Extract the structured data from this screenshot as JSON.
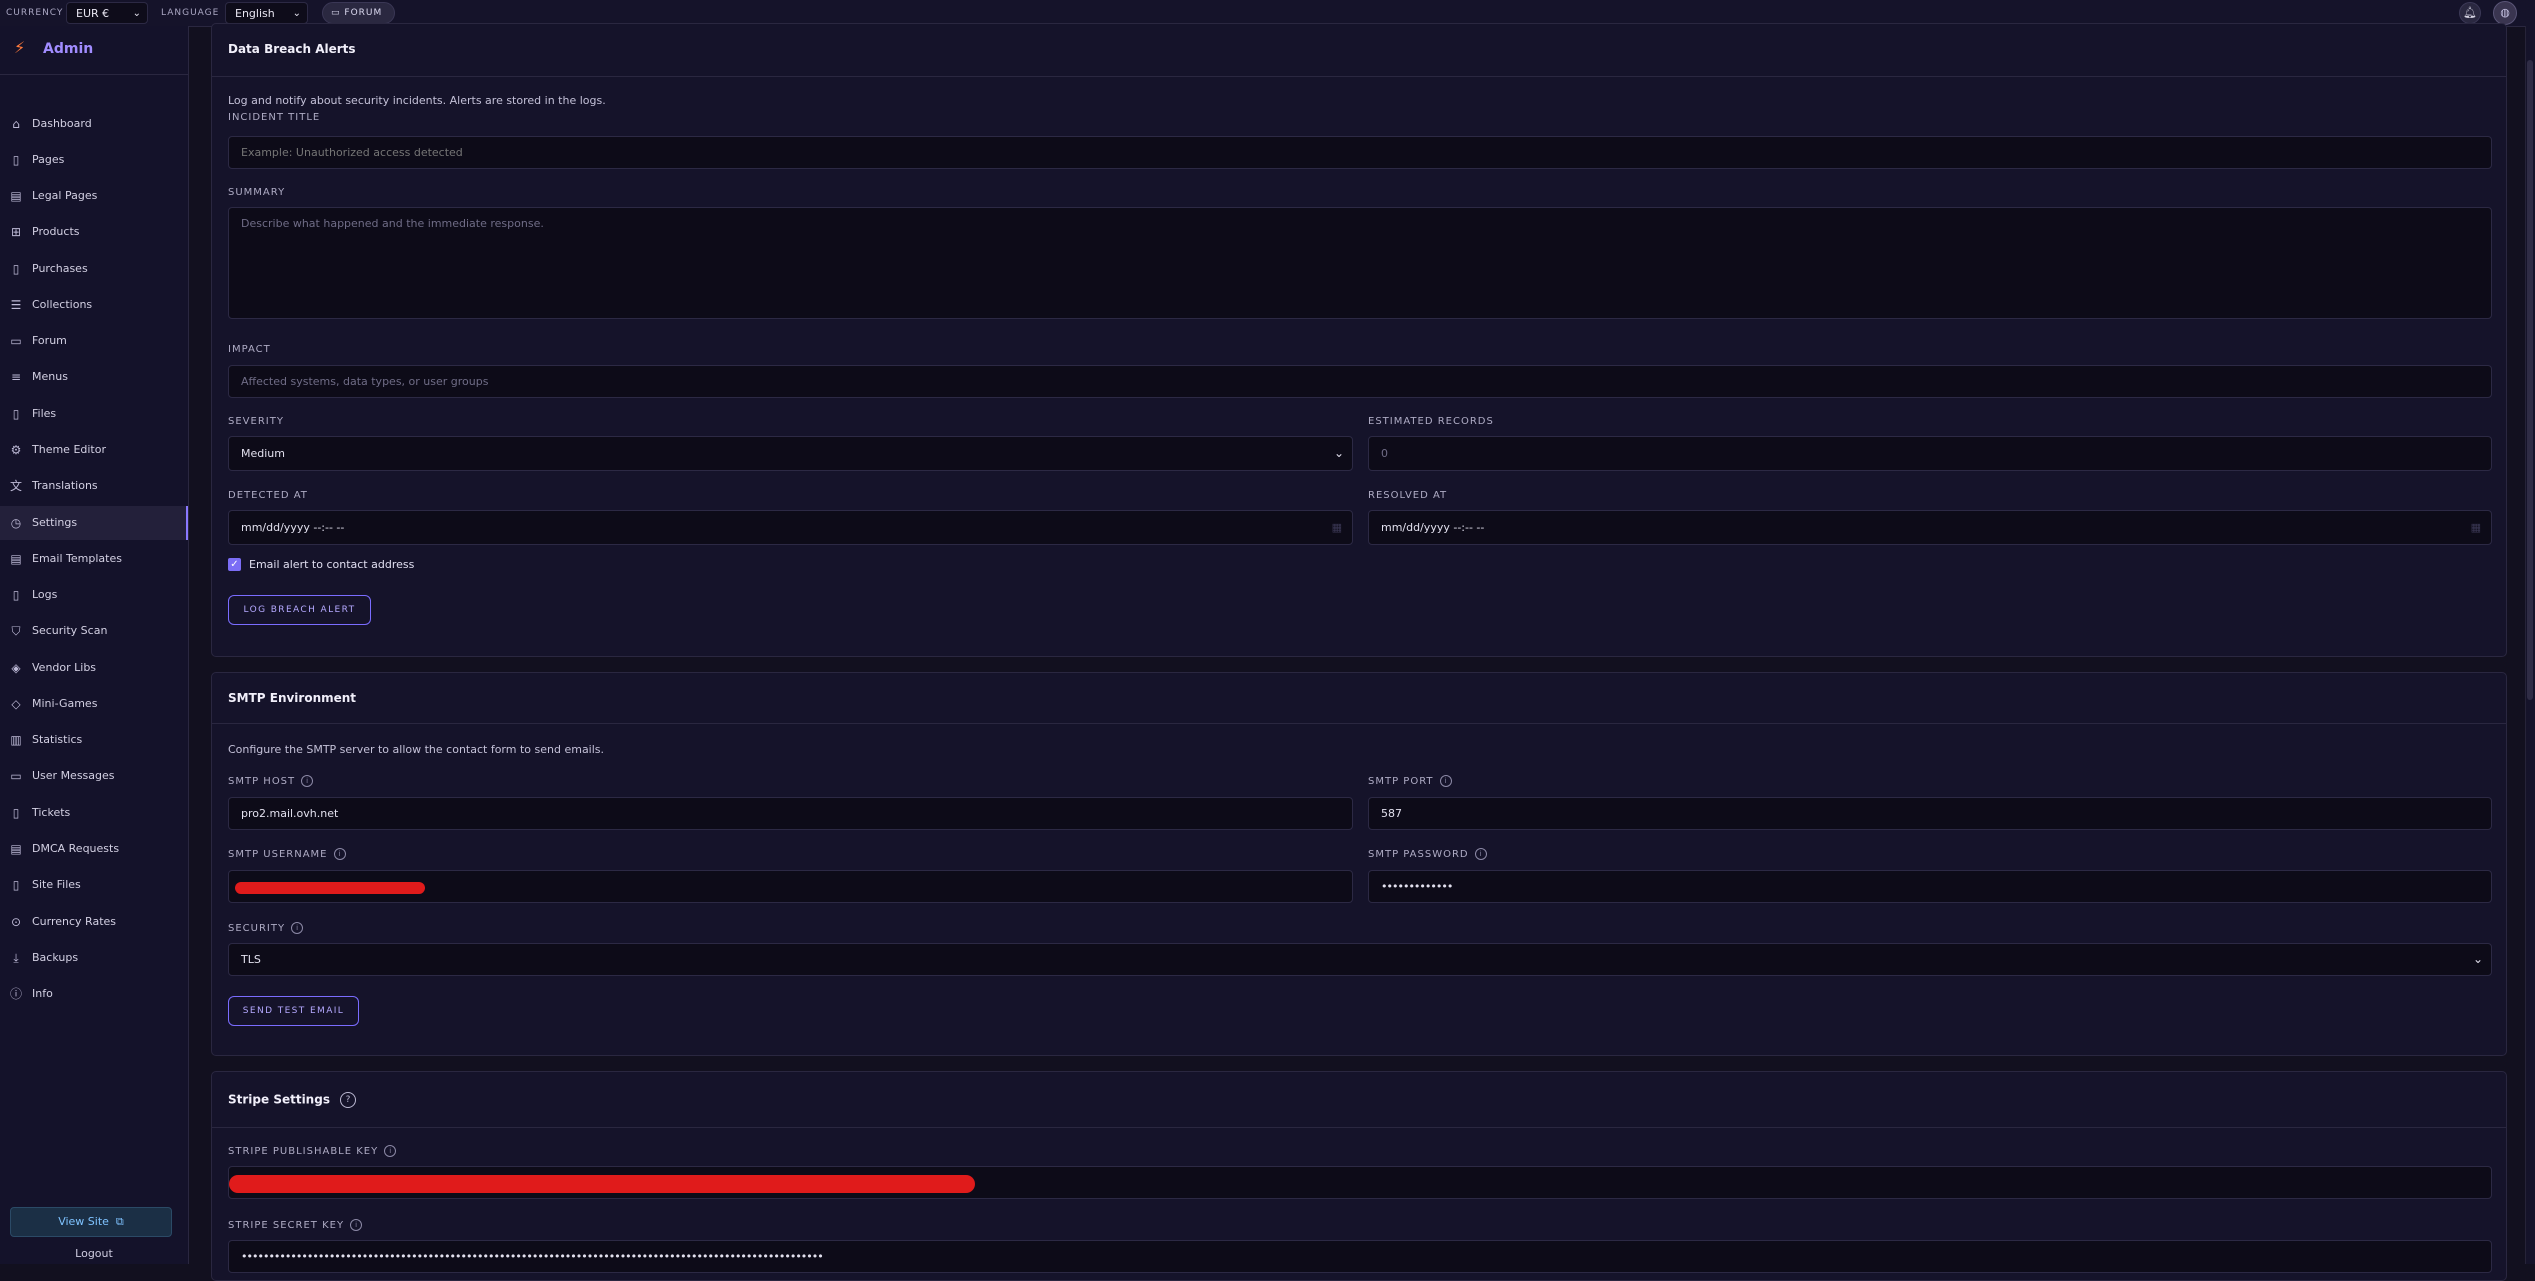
{
  "topbar": {
    "currency_label": "CURRENCY",
    "currency_value": "EUR €",
    "language_label": "LANGUAGE",
    "language_value": "English",
    "forum_label": "FORUM"
  },
  "sidebar": {
    "brand": "Admin",
    "items": [
      {
        "label": "Dashboard",
        "icon": "home-icon"
      },
      {
        "label": "Pages",
        "icon": "page-icon"
      },
      {
        "label": "Legal Pages",
        "icon": "legal-icon"
      },
      {
        "label": "Products",
        "icon": "grid-icon"
      },
      {
        "label": "Purchases",
        "icon": "receipt-icon"
      },
      {
        "label": "Collections",
        "icon": "list-icon"
      },
      {
        "label": "Forum",
        "icon": "chat-icon"
      },
      {
        "label": "Menus",
        "icon": "menu-icon"
      },
      {
        "label": "Files",
        "icon": "file-icon"
      },
      {
        "label": "Theme Editor",
        "icon": "gear-icon"
      },
      {
        "label": "Translations",
        "icon": "translate-icon"
      },
      {
        "label": "Settings",
        "icon": "settings-icon"
      },
      {
        "label": "Email Templates",
        "icon": "mail-icon"
      },
      {
        "label": "Logs",
        "icon": "log-icon"
      },
      {
        "label": "Security Scan",
        "icon": "shield-icon"
      },
      {
        "label": "Vendor Libs",
        "icon": "cube-icon"
      },
      {
        "label": "Mini-Games",
        "icon": "game-icon"
      },
      {
        "label": "Statistics",
        "icon": "chart-icon"
      },
      {
        "label": "User Messages",
        "icon": "inbox-icon"
      },
      {
        "label": "Tickets",
        "icon": "ticket-icon"
      },
      {
        "label": "DMCA Requests",
        "icon": "document-icon"
      },
      {
        "label": "Site Files",
        "icon": "folder-icon"
      },
      {
        "label": "Currency Rates",
        "icon": "currency-icon"
      },
      {
        "label": "Backups",
        "icon": "download-icon"
      },
      {
        "label": "Info",
        "icon": "info-icon"
      }
    ],
    "active": "Settings",
    "view_site": "View Site",
    "logout": "Logout"
  },
  "breach": {
    "title": "Data Breach Alerts",
    "description": "Log and notify about security incidents. Alerts are stored in the logs.",
    "incident_title_label": "INCIDENT TITLE",
    "incident_title_placeholder": "Example: Unauthorized access detected",
    "summary_label": "SUMMARY",
    "summary_placeholder": "Describe what happened and the immediate response.",
    "impact_label": "IMPACT",
    "impact_placeholder": "Affected systems, data types, or user groups",
    "severity_label": "SEVERITY",
    "severity_value": "Medium",
    "estimated_records_label": "ESTIMATED RECORDS",
    "estimated_records_placeholder": "0",
    "detected_at_label": "DETECTED AT",
    "detected_at_value": "mm/dd/yyyy --:-- --",
    "resolved_at_label": "RESOLVED AT",
    "resolved_at_value": "mm/dd/yyyy --:-- --",
    "email_alert_label": "Email alert to contact address",
    "email_alert_checked": true,
    "submit_label": "LOG BREACH ALERT"
  },
  "smtp": {
    "title": "SMTP Environment",
    "description": "Configure the SMTP server to allow the contact form to send emails.",
    "host_label": "SMTP HOST",
    "host_value": "pro2.mail.ovh.net",
    "port_label": "SMTP PORT",
    "port_value": "587",
    "username_label": "SMTP USERNAME",
    "password_label": "SMTP PASSWORD",
    "password_value": "•••••••••••••",
    "security_label": "SECURITY",
    "security_value": "TLS",
    "test_label": "SEND TEST EMAIL"
  },
  "stripe": {
    "title": "Stripe Settings",
    "publishable_label": "STRIPE PUBLISHABLE KEY",
    "secret_label": "STRIPE SECRET KEY",
    "secret_value": "••••••••••••••••••••••••••••••••••••••••••••••••••••••••••••••••••••••••••••••••••••••••••••••••••••••••••"
  }
}
